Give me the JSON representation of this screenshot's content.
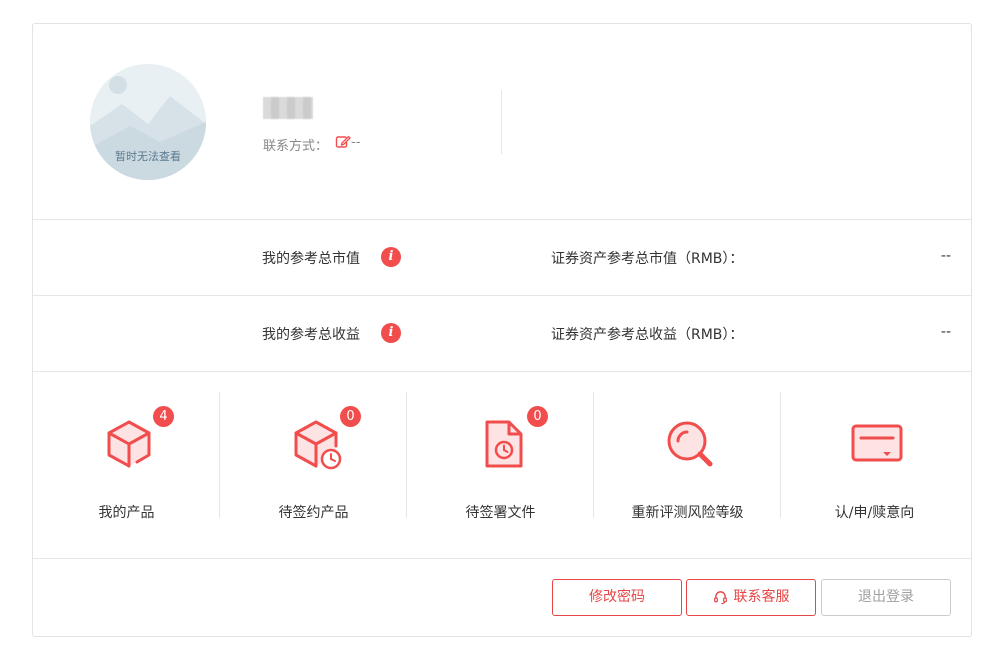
{
  "profile": {
    "avatar_text": "暂时无法查看",
    "contact_label": "联系方式：",
    "contact_value": "--"
  },
  "assets": [
    {
      "title": "我的参考总市值",
      "label": "证券资产参考总市值（RMB）：",
      "value": "--"
    },
    {
      "title": "我的参考总收益",
      "label": "证券资产参考总收益（RMB）：",
      "value": "--"
    }
  ],
  "features": [
    {
      "label": "我的产品",
      "icon": "box-icon",
      "badge": "4"
    },
    {
      "label": "待签约产品",
      "icon": "box-clock-icon",
      "badge": "0"
    },
    {
      "label": "待签署文件",
      "icon": "document-clock-icon",
      "badge": "0"
    },
    {
      "label": "重新评测风险等级",
      "icon": "magnifier-icon",
      "badge": ""
    },
    {
      "label": "认/申/赎意向",
      "icon": "card-icon",
      "badge": ""
    }
  ],
  "buttons": {
    "change_password": "修改密码",
    "contact_service": "联系客服",
    "logout": "退出登录"
  },
  "colors": {
    "accent": "#f14d4d",
    "border": "#e6e6e6"
  }
}
